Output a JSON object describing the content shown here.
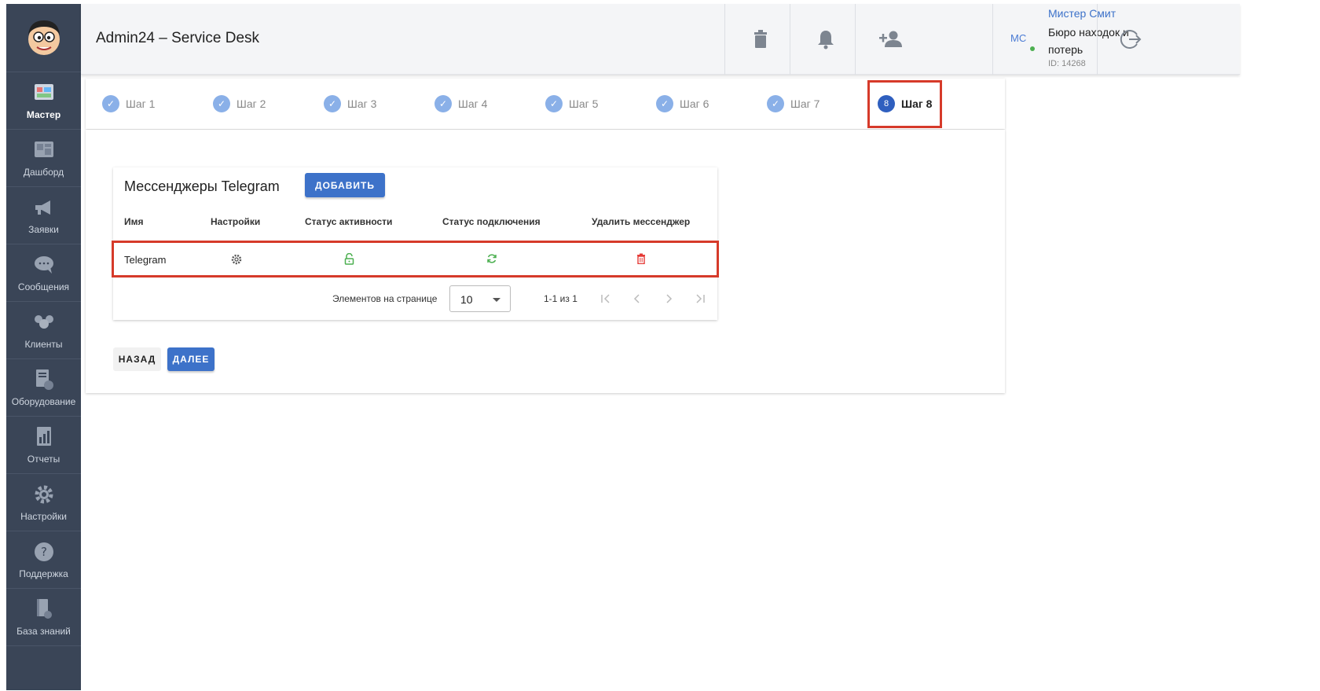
{
  "header": {
    "title": "Admin24 – Service Desk",
    "user": {
      "initials": "MC",
      "name": "Мистер Смит",
      "org": "Бюро находок и потерь",
      "id": "ID: 14268"
    },
    "icons": [
      "trash-icon",
      "bell-icon",
      "add-person-icon",
      "logout-icon"
    ]
  },
  "sidebar": {
    "items": [
      {
        "label": "Мастер",
        "icon": "wizard-icon",
        "active": true
      },
      {
        "label": "Дашборд",
        "icon": "dashboard-icon"
      },
      {
        "label": "Заявки",
        "icon": "megaphone-icon"
      },
      {
        "label": "Сообщения",
        "icon": "chat-icon"
      },
      {
        "label": "Клиенты",
        "icon": "clients-icon"
      },
      {
        "label": "Оборудование",
        "icon": "equipment-icon"
      },
      {
        "label": "Отчеты",
        "icon": "report-icon"
      },
      {
        "label": "Настройки",
        "icon": "gear-icon"
      },
      {
        "label": "Поддержка",
        "icon": "help-icon"
      },
      {
        "label": "База знаний",
        "icon": "knowledge-base-icon"
      }
    ]
  },
  "stepper": {
    "steps": [
      {
        "label": "Шаг 1",
        "state": "done"
      },
      {
        "label": "Шаг 2",
        "state": "done"
      },
      {
        "label": "Шаг 3",
        "state": "done"
      },
      {
        "label": "Шаг 4",
        "state": "done"
      },
      {
        "label": "Шаг 5",
        "state": "done"
      },
      {
        "label": "Шаг 6",
        "state": "done"
      },
      {
        "label": "Шаг 7",
        "state": "done"
      },
      {
        "label": "Шаг 8",
        "state": "current",
        "number": "8"
      }
    ]
  },
  "card": {
    "title": "Мессенджеры Telegram",
    "add_label": "ДОБАВИТЬ",
    "columns": [
      "Имя",
      "Настройки",
      "Статус активности",
      "Статус подключения",
      "Удалить мессенджер"
    ],
    "rows": [
      {
        "name": "Telegram",
        "settings_icon": "gear-icon",
        "activity_icon": "unlock-icon",
        "connection_icon": "sync-icon",
        "delete_icon": "delete-icon"
      }
    ],
    "pagination": {
      "per_page_label": "Элементов на странице",
      "per_page_value": "10",
      "range": "1-1 из 1"
    }
  },
  "actions": {
    "back_label": "НАЗАД",
    "next_label": "ДАЛЕЕ"
  },
  "colors": {
    "sidebar": "#3a4557",
    "accent": "#3d72c9",
    "highlight": "#d63a2a",
    "success": "#4caf50",
    "danger": "#e53935"
  }
}
